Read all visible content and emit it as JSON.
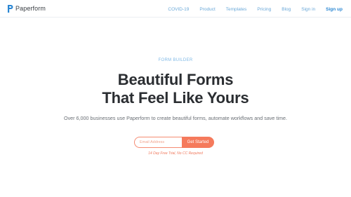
{
  "header": {
    "brand": "Paperform",
    "logo_icon": "paperform-logo-icon",
    "nav": [
      {
        "label": "COVID-19"
      },
      {
        "label": "Product"
      },
      {
        "label": "Templates"
      },
      {
        "label": "Pricing"
      },
      {
        "label": "Blog"
      },
      {
        "label": "Sign in"
      },
      {
        "label": "Sign up"
      }
    ]
  },
  "hero": {
    "eyebrow": "FORM BUILDER",
    "headline_line1": "Beautiful Forms",
    "headline_line2": "That Feel Like Yours",
    "subtext": "Over 6,000 businesses use Paperform to create beautiful forms, automate workflows and save time.",
    "email_placeholder": "Email Address",
    "cta_label": "Get Started",
    "trial_note": "14 Day Free Trial, No CC Required"
  },
  "colors": {
    "accent": "#f57a5c",
    "nav_link": "#6aa8d8",
    "headline": "#2a2d31"
  }
}
